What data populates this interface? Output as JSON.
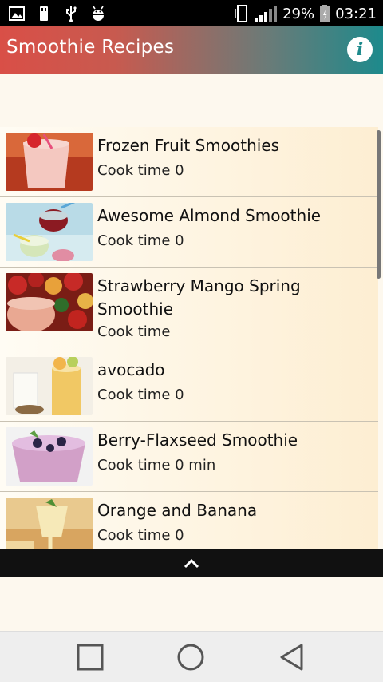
{
  "status_bar": {
    "icons_left": [
      "image-icon",
      "usb-storage-icon",
      "usb-icon",
      "android-debug-icon"
    ],
    "battery_percent": "29%",
    "time": "03:21"
  },
  "app_bar": {
    "title": "Smoothie Recipes",
    "info_icon": "info-icon"
  },
  "recipes": [
    {
      "title": "Frozen Fruit Smoothies",
      "cook_time": "Cook time 0"
    },
    {
      "title": "Awesome Almond Smoothie",
      "cook_time": "Cook time 0"
    },
    {
      "title": "Strawberry Mango Spring Smoothie",
      "cook_time": "Cook time"
    },
    {
      "title": "avocado",
      "cook_time": "Cook time 0"
    },
    {
      "title": "Berry-Flaxseed Smoothie",
      "cook_time": "Cook time 0 min"
    },
    {
      "title": "Orange and Banana",
      "cook_time": "Cook time 0"
    }
  ],
  "nav_bar": {
    "buttons": [
      "recents-icon",
      "home-icon",
      "back-icon"
    ]
  }
}
